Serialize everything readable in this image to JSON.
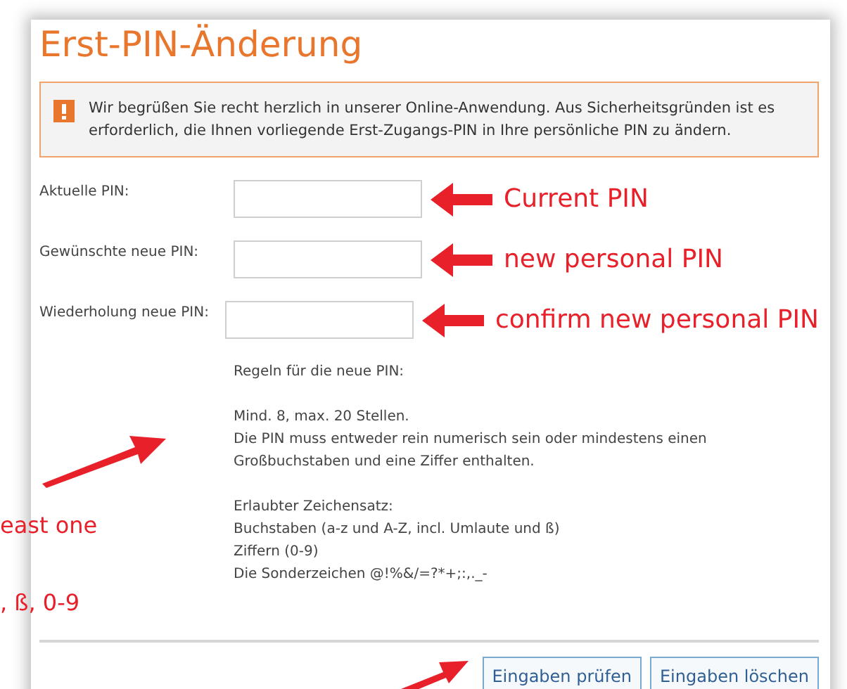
{
  "heading": "Erst-PIN-Änderung",
  "notice": {
    "text": "Wir begrüßen Sie recht herzlich in unserer Online-Anwendung. Aus Sicherheitsgründen ist es erforderlich, die Ihnen vorliegende Erst-Zugangs-PIN in Ihre persönliche PIN zu ändern."
  },
  "fields": [
    {
      "label": "Aktuelle PIN:",
      "annotation": "Current PIN"
    },
    {
      "label": "Gewünschte neue PIN:",
      "annotation": "new personal PIN"
    },
    {
      "label": "Wiederholung neue PIN:",
      "annotation": "confirm new personal PIN"
    }
  ],
  "rules": {
    "title": "Regeln für die neue PIN:",
    "paragraphs": [
      [
        "Mind. 8, max. 20 Stellen.",
        "Die PIN muss entweder rein numerisch sein oder mindestens einen",
        "Großbuchstaben und eine Ziffer enthalten."
      ],
      [
        "Erlaubter Zeichensatz:",
        "Buchstaben (a-z und A-Z, incl. Umlaute und ß)",
        "Ziffern (0-9)",
        "Die Sonderzeichen @!%&/=?*+;:,._-"
      ]
    ]
  },
  "side_notes": [
    "east one",
    ", ß, 0-9"
  ],
  "buttons": [
    {
      "label": "Eingaben prüfen"
    },
    {
      "label": "Eingaben löschen"
    }
  ]
}
